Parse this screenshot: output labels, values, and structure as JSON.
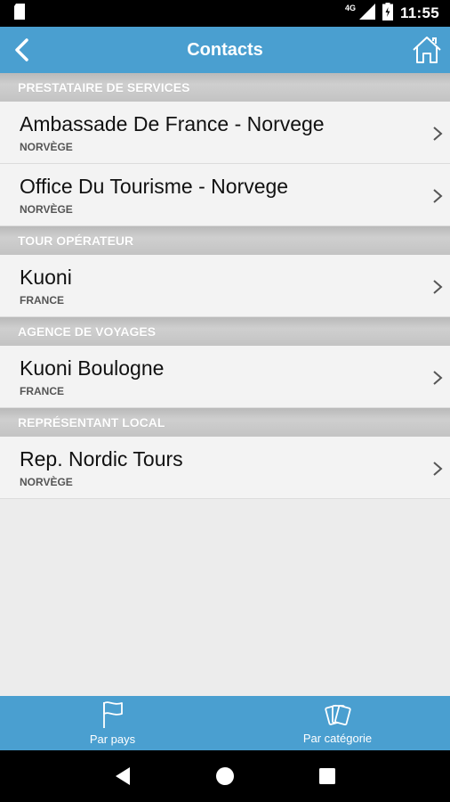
{
  "status_bar": {
    "network": "4G",
    "time": "11:55"
  },
  "app_bar": {
    "title": "Contacts"
  },
  "sections": [
    {
      "header": "PRESTATAIRE DE SERVICES",
      "items": [
        {
          "title": "Ambassade De France - Norvege",
          "subtitle": "NORVÈGE"
        },
        {
          "title": "Office Du Tourisme - Norvege",
          "subtitle": "NORVÈGE"
        }
      ]
    },
    {
      "header": "TOUR OPÉRATEUR",
      "items": [
        {
          "title": "Kuoni",
          "subtitle": "FRANCE"
        }
      ]
    },
    {
      "header": "AGENCE DE VOYAGES",
      "items": [
        {
          "title": "Kuoni Boulogne",
          "subtitle": "FRANCE"
        }
      ]
    },
    {
      "header": "REPRÉSENTANT LOCAL",
      "items": [
        {
          "title": "Rep. Nordic Tours",
          "subtitle": "NORVÈGE"
        }
      ]
    }
  ],
  "bottom_tabs": [
    {
      "label": "Par pays",
      "icon": "flag-icon"
    },
    {
      "label": "Par catégorie",
      "icon": "cards-icon"
    }
  ],
  "colors": {
    "accent": "#4a9fd0",
    "section_header": "#c4c4c4",
    "row_bg": "#f3f3f3"
  }
}
